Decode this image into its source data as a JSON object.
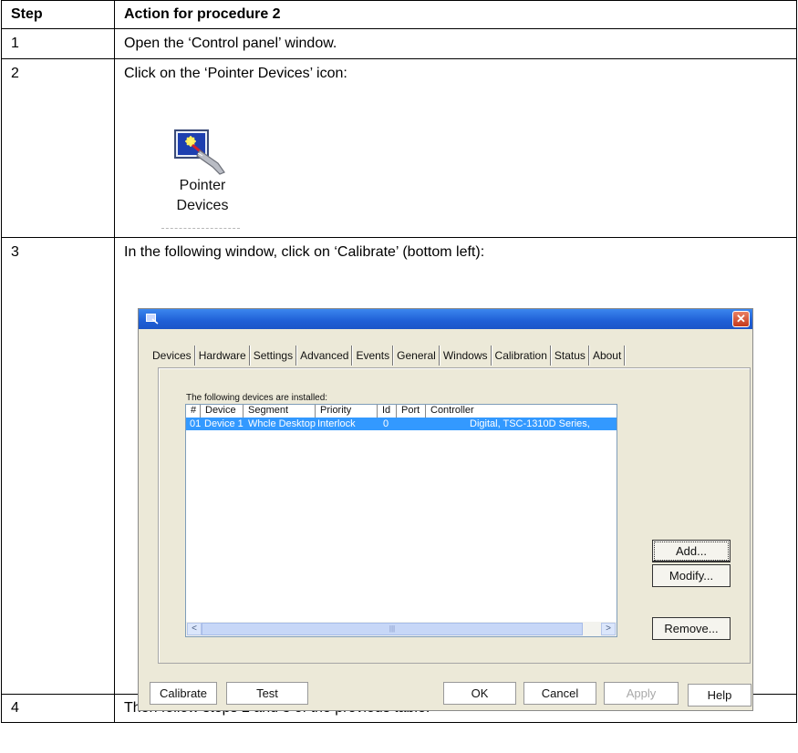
{
  "table": {
    "header": {
      "step": "Step",
      "action": "Action for procedure 2"
    },
    "rows": [
      {
        "step": "1",
        "action": "Open the ‘Control panel’ window."
      },
      {
        "step": "2",
        "action": "Click on the ‘Pointer Devices’ icon:"
      },
      {
        "step": "3",
        "action": "In the following window, click on ‘Calibrate’ (bottom left):"
      },
      {
        "step": "4",
        "action": "Then follow steps 2 and 3 of the previous table."
      }
    ]
  },
  "pointer_icon": {
    "label_line1": "Pointer",
    "label_line2": "Devices",
    "icon": "pointer-devices-icon"
  },
  "dialog": {
    "close_symbol": "✕",
    "tabs": [
      "Devices",
      "Hardware",
      "Settings",
      "Advanced",
      "Events",
      "General",
      "Windows",
      "Calibration",
      "Status",
      "About"
    ],
    "installed_label": "The following devices are installed:",
    "columns": [
      "#",
      "Device",
      "Segment",
      "Priority",
      "Id",
      "Port",
      "Controller"
    ],
    "row": {
      "num": "01",
      "device": "Device 1",
      "segment": "Whcle Desktop",
      "priority": "Interlock",
      "id": "0",
      "port": "",
      "controller": "Digital, TSC-1310D Series,"
    },
    "scroll_left": "<",
    "scroll_right": ">",
    "scroll_grip": "|||",
    "side_buttons": {
      "add": "Add...",
      "modify": "Modify...",
      "remove": "Remove..."
    },
    "bottom_buttons": {
      "calibrate": "Calibrate",
      "test": "Test",
      "ok": "OK",
      "cancel": "Cancel",
      "apply": "Apply",
      "help": "Help"
    },
    "colors": {
      "titlebar": "#1f5fd6",
      "selection": "#3399ff",
      "face": "#ece9d8"
    }
  }
}
